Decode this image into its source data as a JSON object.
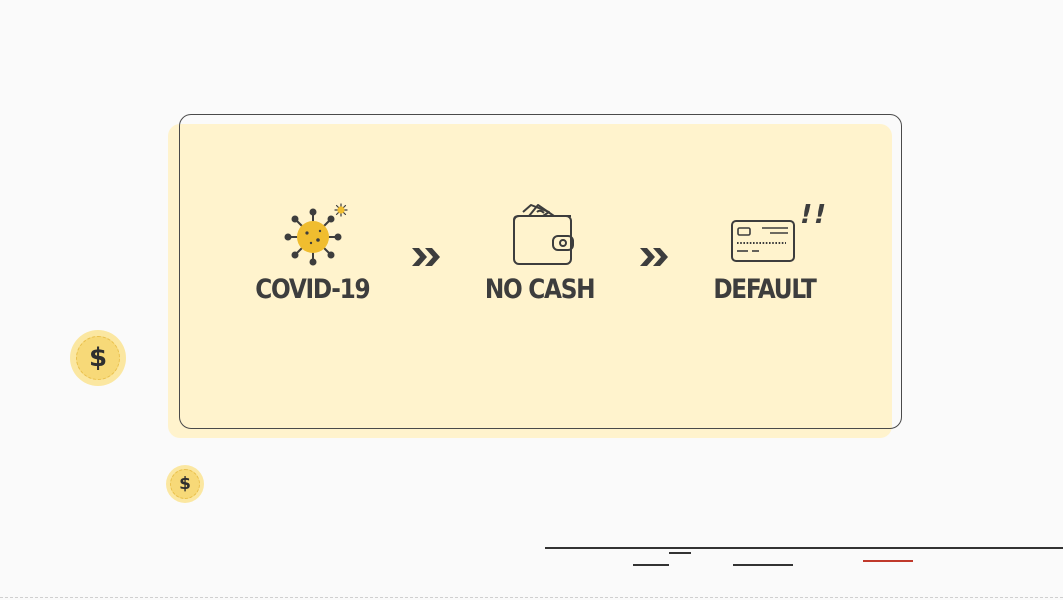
{
  "flow": {
    "steps": [
      {
        "label": "COVID-19",
        "icon": "virus-icon"
      },
      {
        "label": "NO CASH",
        "icon": "wallet-icon"
      },
      {
        "label": "DEFAULT",
        "icon": "credit-card-icon"
      }
    ],
    "connector_icon": "double-chevron-right-icon",
    "alert_text": "!!"
  },
  "decorations": {
    "coin_symbol": "$"
  },
  "colors": {
    "card_fill": "#fff3cd",
    "accent_yellow": "#f0bd2f",
    "coin": "#f7d978",
    "ink": "#3d3d3d",
    "background": "#fafafa"
  }
}
